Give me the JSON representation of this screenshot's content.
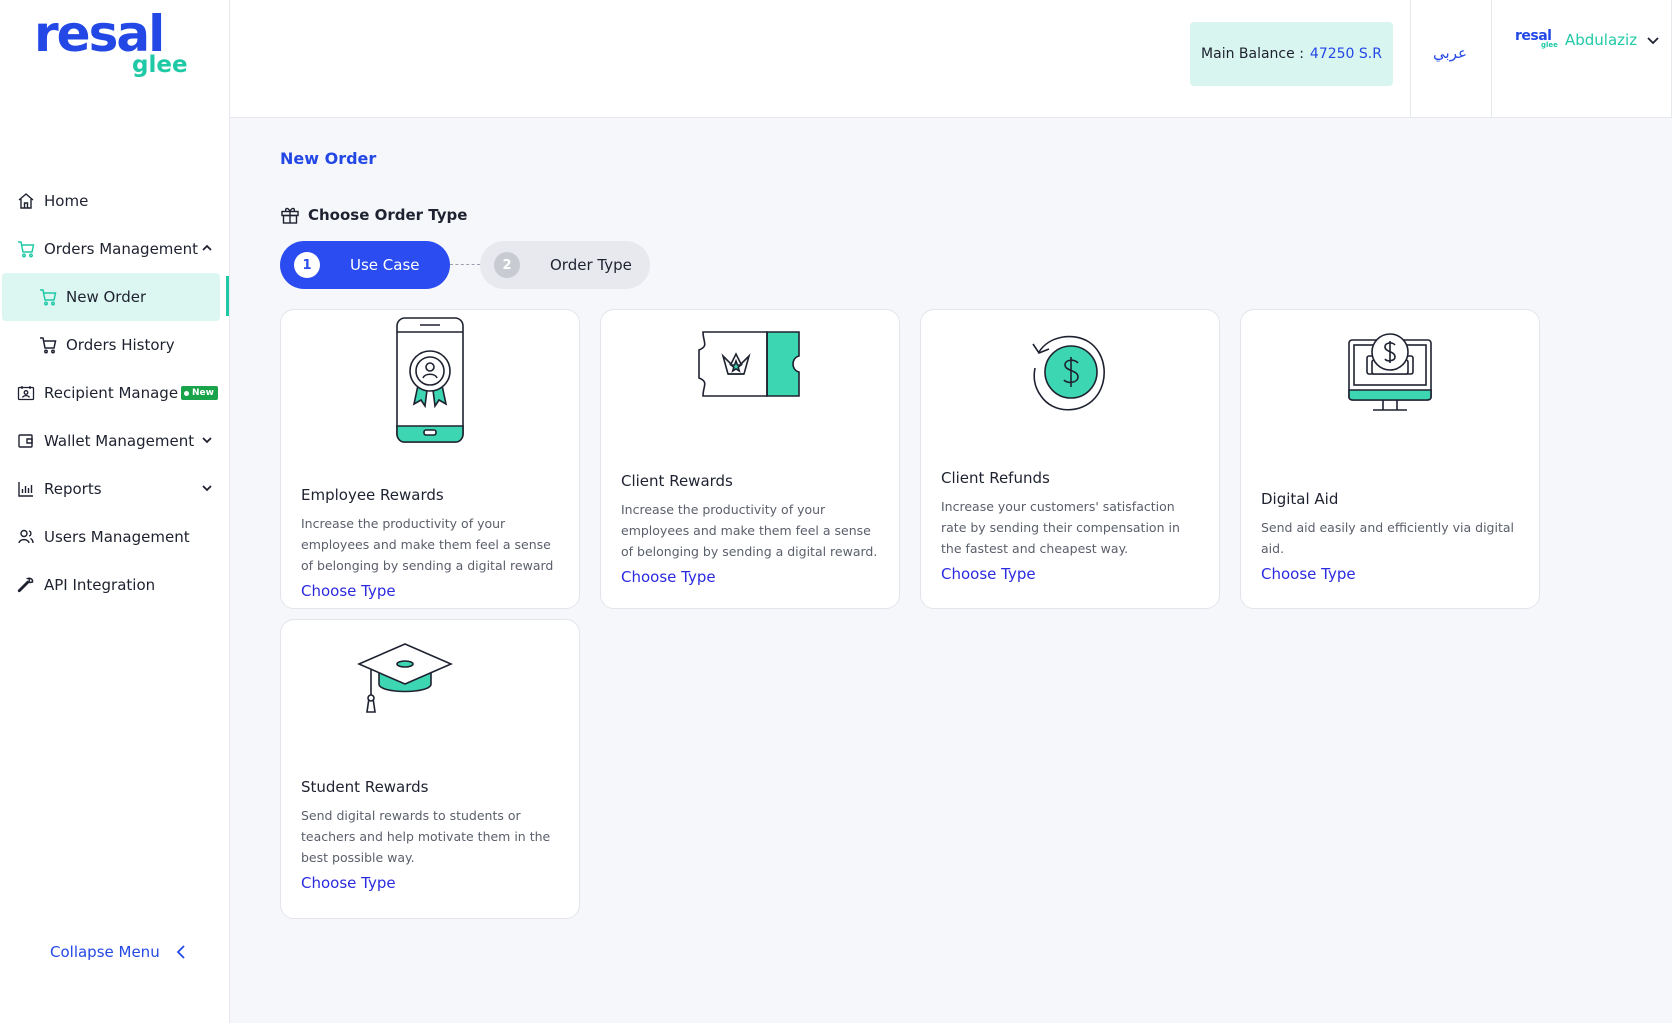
{
  "brand": {
    "logo_main": "resal",
    "logo_sub": "glee"
  },
  "sidebar": {
    "items": [
      {
        "label": "Home"
      },
      {
        "label": "Orders Management"
      },
      {
        "label": "New Order"
      },
      {
        "label": "Orders History"
      },
      {
        "label": "Recipient Management",
        "badge": "New"
      },
      {
        "label": "Wallet Management"
      },
      {
        "label": "Reports"
      },
      {
        "label": "Users Management"
      },
      {
        "label": "API Integration"
      }
    ],
    "collapse_label": "Collapse Menu"
  },
  "header": {
    "balance_label": "Main Balance :",
    "balance_value": "47250 S.R",
    "language": "عربي",
    "user_name": "Abdulaziz"
  },
  "main": {
    "title": "New Order",
    "section_title": "Choose Order Type",
    "steps": [
      {
        "num": "1",
        "label": "Use Case"
      },
      {
        "num": "2",
        "label": "Order Type"
      }
    ],
    "cards": [
      {
        "title": "Employee Rewards",
        "desc": "Increase the productivity of your employees and make them feel a sense of belonging by sending a digital reward",
        "link": "Choose Type"
      },
      {
        "title": "Client Rewards",
        "desc": "Increase the productivity of your employees and make them feel a sense of belonging by sending a digital reward.",
        "link": "Choose Type"
      },
      {
        "title": "Client Refunds",
        "desc": "Increase your customers' satisfaction rate by sending their compensation in the fastest and cheapest way.",
        "link": "Choose Type"
      },
      {
        "title": "Digital Aid",
        "desc": "Send aid easily and efficiently via digital aid.",
        "link": "Choose Type"
      },
      {
        "title": "Student Rewards",
        "desc": "Send digital rewards to students or teachers and help motivate them in the best possible way.",
        "link": "Choose Type"
      }
    ]
  },
  "colors": {
    "primary": "#2348e6",
    "accent": "#20c9a6",
    "step_active": "#2a4cf0"
  }
}
